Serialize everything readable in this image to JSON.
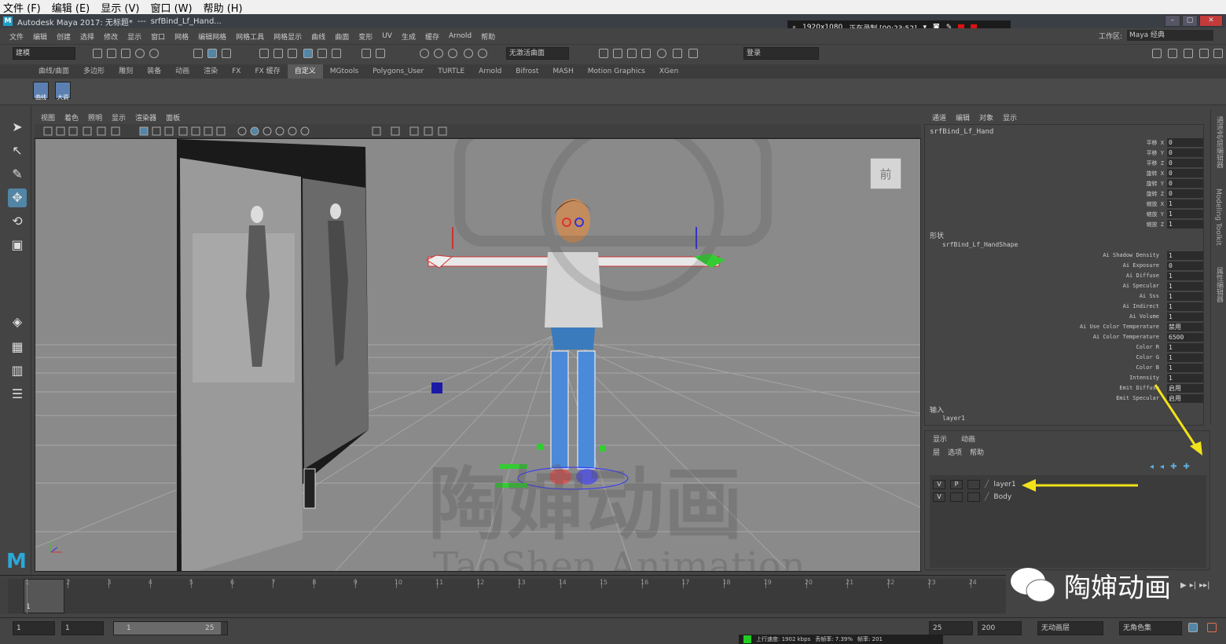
{
  "outer_menu": [
    "文件 (F)",
    "编辑 (E)",
    "显示 (V)",
    "窗口 (W)",
    "帮助 (H)"
  ],
  "titlebar": {
    "app": "Autodesk Maya 2017: 无标题*",
    "sep": "---",
    "object": "srfBind_Lf_Hand..."
  },
  "recorder": {
    "resolution": "1920x1080",
    "status": "正在录制 [00:23:52]"
  },
  "maya_menu": [
    "文件",
    "编辑",
    "创建",
    "选择",
    "修改",
    "显示",
    "窗口",
    "网格",
    "编辑网格",
    "网格工具",
    "网格显示",
    "曲线",
    "曲面",
    "变形",
    "UV",
    "生成",
    "缓存",
    "Arnold",
    "帮助"
  ],
  "workspace": {
    "label": "工作区:",
    "value": "Maya 经典"
  },
  "status_line": {
    "mode": "建模",
    "surface_field": "无激活曲面",
    "login": "登录"
  },
  "shelf_tabs": [
    "曲线/曲面",
    "多边形",
    "雕刻",
    "装备",
    "动画",
    "渲染",
    "FX",
    "FX 缓存",
    "自定义",
    "MGtools",
    "Polygons_User",
    "TURTLE",
    "Arnold",
    "Bifrost",
    "MASH",
    "Motion Graphics",
    "XGen"
  ],
  "shelf_active_tab": "自定义",
  "shelf_buttons": [
    "曲线图",
    "大调帧"
  ],
  "viewport_menu": [
    "视图",
    "着色",
    "照明",
    "显示",
    "渲染器",
    "面板"
  ],
  "viewcube_label": "前",
  "watermark": {
    "cn": "陶婶动画",
    "en": "TaoShen Animation"
  },
  "channelbox": {
    "menu": [
      "通道",
      "编辑",
      "对象",
      "显示"
    ],
    "object": "srfBind_Lf_Hand",
    "transform": [
      {
        "label": "平移 X",
        "value": "0"
      },
      {
        "label": "平移 Y",
        "value": "0"
      },
      {
        "label": "平移 Z",
        "value": "0"
      },
      {
        "label": "旋转 X",
        "value": "0"
      },
      {
        "label": "旋转 Y",
        "value": "0"
      },
      {
        "label": "旋转 Z",
        "value": "0"
      },
      {
        "label": "缩放 X",
        "value": "1"
      },
      {
        "label": "缩放 Y",
        "value": "1"
      },
      {
        "label": "缩放 Z",
        "value": "1"
      }
    ],
    "shape_header": "形状",
    "shape_name": "srfBind_Lf_HandShape",
    "shape": [
      {
        "label": "Ai Shadow Density",
        "value": "1"
      },
      {
        "label": "Ai Exposure",
        "value": "0"
      },
      {
        "label": "Ai Diffuse",
        "value": "1"
      },
      {
        "label": "Ai Specular",
        "value": "1"
      },
      {
        "label": "Ai Sss",
        "value": "1"
      },
      {
        "label": "Ai Indirect",
        "value": "1"
      },
      {
        "label": "Ai Volume",
        "value": "1"
      },
      {
        "label": "Ai Use Color Temperature",
        "value": "禁用"
      },
      {
        "label": "Ai Color Temperature",
        "value": "6500"
      },
      {
        "label": "Color R",
        "value": "1"
      },
      {
        "label": "Color G",
        "value": "1"
      },
      {
        "label": "Color B",
        "value": "1"
      },
      {
        "label": "Intensity",
        "value": "1"
      },
      {
        "label": "Emit Diffuse",
        "value": "启用"
      },
      {
        "label": "Emit Specular",
        "value": "启用"
      }
    ],
    "inputs_header": "输入",
    "inputs": [
      "layer1"
    ]
  },
  "side_tabs": [
    "通道盒/层编辑器",
    "Modeling Toolkit",
    "属性编辑器"
  ],
  "layer_editor": {
    "tabs": [
      "显示",
      "动画"
    ],
    "menu": [
      "层",
      "选项",
      "帮助"
    ],
    "layers": [
      {
        "v": "V",
        "p": "P",
        "name": "layer1"
      },
      {
        "v": "V",
        "p": "",
        "name": "Body"
      }
    ]
  },
  "timeline": {
    "ticks": [
      "1",
      "2",
      "3",
      "4",
      "5",
      "6",
      "7",
      "8",
      "9",
      "10",
      "11",
      "12",
      "13",
      "14",
      "15",
      "16",
      "17",
      "18",
      "19",
      "20",
      "21",
      "22",
      "23",
      "24"
    ],
    "current_frame": "1"
  },
  "range": {
    "start": "1",
    "playback_start": "1",
    "slider_start": "1",
    "slider_end": "25",
    "playback_end": "25",
    "end": "200",
    "anim_layer": "无动画层",
    "char_set": "无角色集"
  },
  "bottom_status": {
    "upload": "上行速度: 1902 kbps",
    "loss": "丢帧率: 7.39%",
    "delay": "帧率: 201"
  },
  "wechat_label": "陶婶动画",
  "colors": {
    "ui_bg": "#444444",
    "viewport_bg": "#8a8a8a",
    "accent": "#5285a6",
    "annotation_arrow": "#f2e21a",
    "maya_logo": "#2aa8d8"
  }
}
